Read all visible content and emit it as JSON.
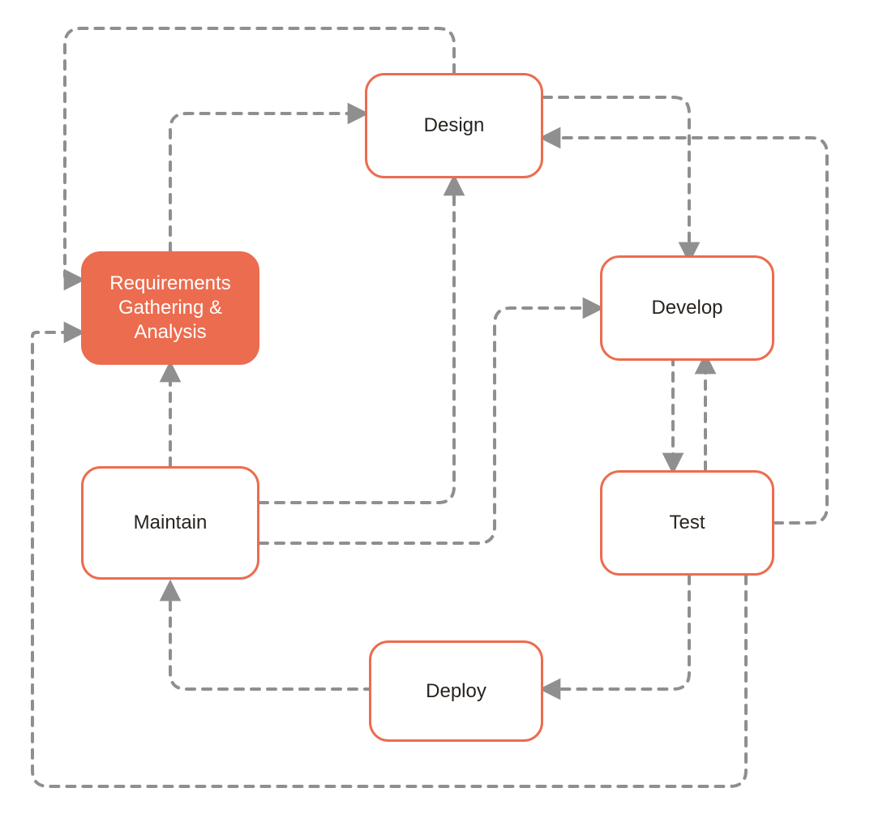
{
  "colors": {
    "nodeBorder": "#ec6c4f",
    "nodeFill": "#ec6c4f",
    "edge": "#8f8f8f",
    "arrowFill": "#8f8f8f",
    "textDark": "#28231f",
    "textLight": "#ffffff"
  },
  "nodes": {
    "requirements": {
      "label": "Requirements\nGathering &\nAnalysis",
      "filled": true
    },
    "design": {
      "label": "Design",
      "filled": false
    },
    "develop": {
      "label": "Develop",
      "filled": false
    },
    "test": {
      "label": "Test",
      "filled": false
    },
    "deploy": {
      "label": "Deploy",
      "filled": false
    },
    "maintain": {
      "label": "Maintain",
      "filled": false
    }
  },
  "edges_description": [
    "Requirements → Design",
    "Design → Develop",
    "Develop → Test",
    "Test → Deploy",
    "Deploy → Maintain",
    "Maintain → Requirements",
    "Maintain → Design",
    "Maintain → Develop",
    "Test → Design (feedback)",
    "Test → Requirements (feedback, outer loop)",
    "Design → Requirements (outer top loop)"
  ]
}
